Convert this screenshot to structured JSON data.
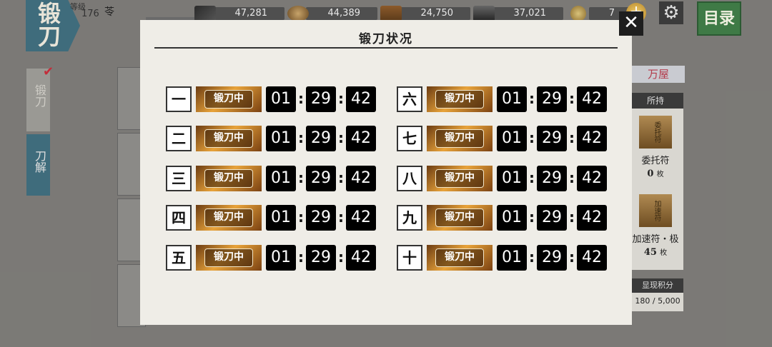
{
  "header": {
    "title": "锻刀",
    "level_label": "等级",
    "level_value": "176",
    "player_name": "苓"
  },
  "resources": [
    {
      "icon": "charcoal-icon",
      "value": "47,281"
    },
    {
      "icon": "tamahagane-icon",
      "value": "44,389"
    },
    {
      "icon": "coolant-icon",
      "value": "24,750"
    },
    {
      "icon": "whetstone-icon",
      "value": "37,021"
    },
    {
      "icon": "koban-coin-icon",
      "value": "7"
    }
  ],
  "side_tabs": [
    "锻刀",
    "刀解"
  ],
  "menu_label": "目录",
  "shop": {
    "tab_label": "万屋",
    "owned_header": "所持",
    "items": [
      {
        "icon_text": "委托符",
        "name": "委托符",
        "qty": "0",
        "unit": "枚"
      },
      {
        "icon_text": "加速符",
        "name": "加速符・极",
        "qty": "45",
        "unit": "枚"
      }
    ]
  },
  "score": {
    "label": "显现积分",
    "value": "180 / 5,000"
  },
  "modal": {
    "title": "锻刀状况",
    "close_label": "✕",
    "slots": [
      {
        "num": "一",
        "status": "锻刀中",
        "h": "01",
        "m": "29",
        "s": "42"
      },
      {
        "num": "二",
        "status": "锻刀中",
        "h": "01",
        "m": "29",
        "s": "42"
      },
      {
        "num": "三",
        "status": "锻刀中",
        "h": "01",
        "m": "29",
        "s": "42"
      },
      {
        "num": "四",
        "status": "锻刀中",
        "h": "01",
        "m": "29",
        "s": "42"
      },
      {
        "num": "五",
        "status": "锻刀中",
        "h": "01",
        "m": "29",
        "s": "42"
      },
      {
        "num": "六",
        "status": "锻刀中",
        "h": "01",
        "m": "29",
        "s": "42"
      },
      {
        "num": "七",
        "status": "锻刀中",
        "h": "01",
        "m": "29",
        "s": "42"
      },
      {
        "num": "八",
        "status": "锻刀中",
        "h": "01",
        "m": "29",
        "s": "42"
      },
      {
        "num": "九",
        "status": "锻刀中",
        "h": "01",
        "m": "29",
        "s": "42"
      },
      {
        "num": "十",
        "status": "锻刀中",
        "h": "01",
        "m": "29",
        "s": "42"
      }
    ]
  }
}
